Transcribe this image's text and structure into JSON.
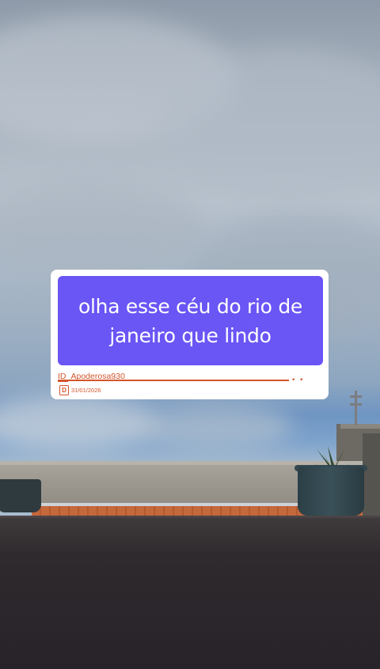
{
  "caption": {
    "text": "olha esse céu do rio de janeiro que lindo",
    "background_color": "#6a55f5",
    "text_color": "#ffffff"
  },
  "info": {
    "id_label": "ID",
    "username": "Apoderosa930",
    "date_icon_letter": "D",
    "date": "31/01/2026",
    "dots": "• •",
    "accent_color": "#d4542a"
  }
}
